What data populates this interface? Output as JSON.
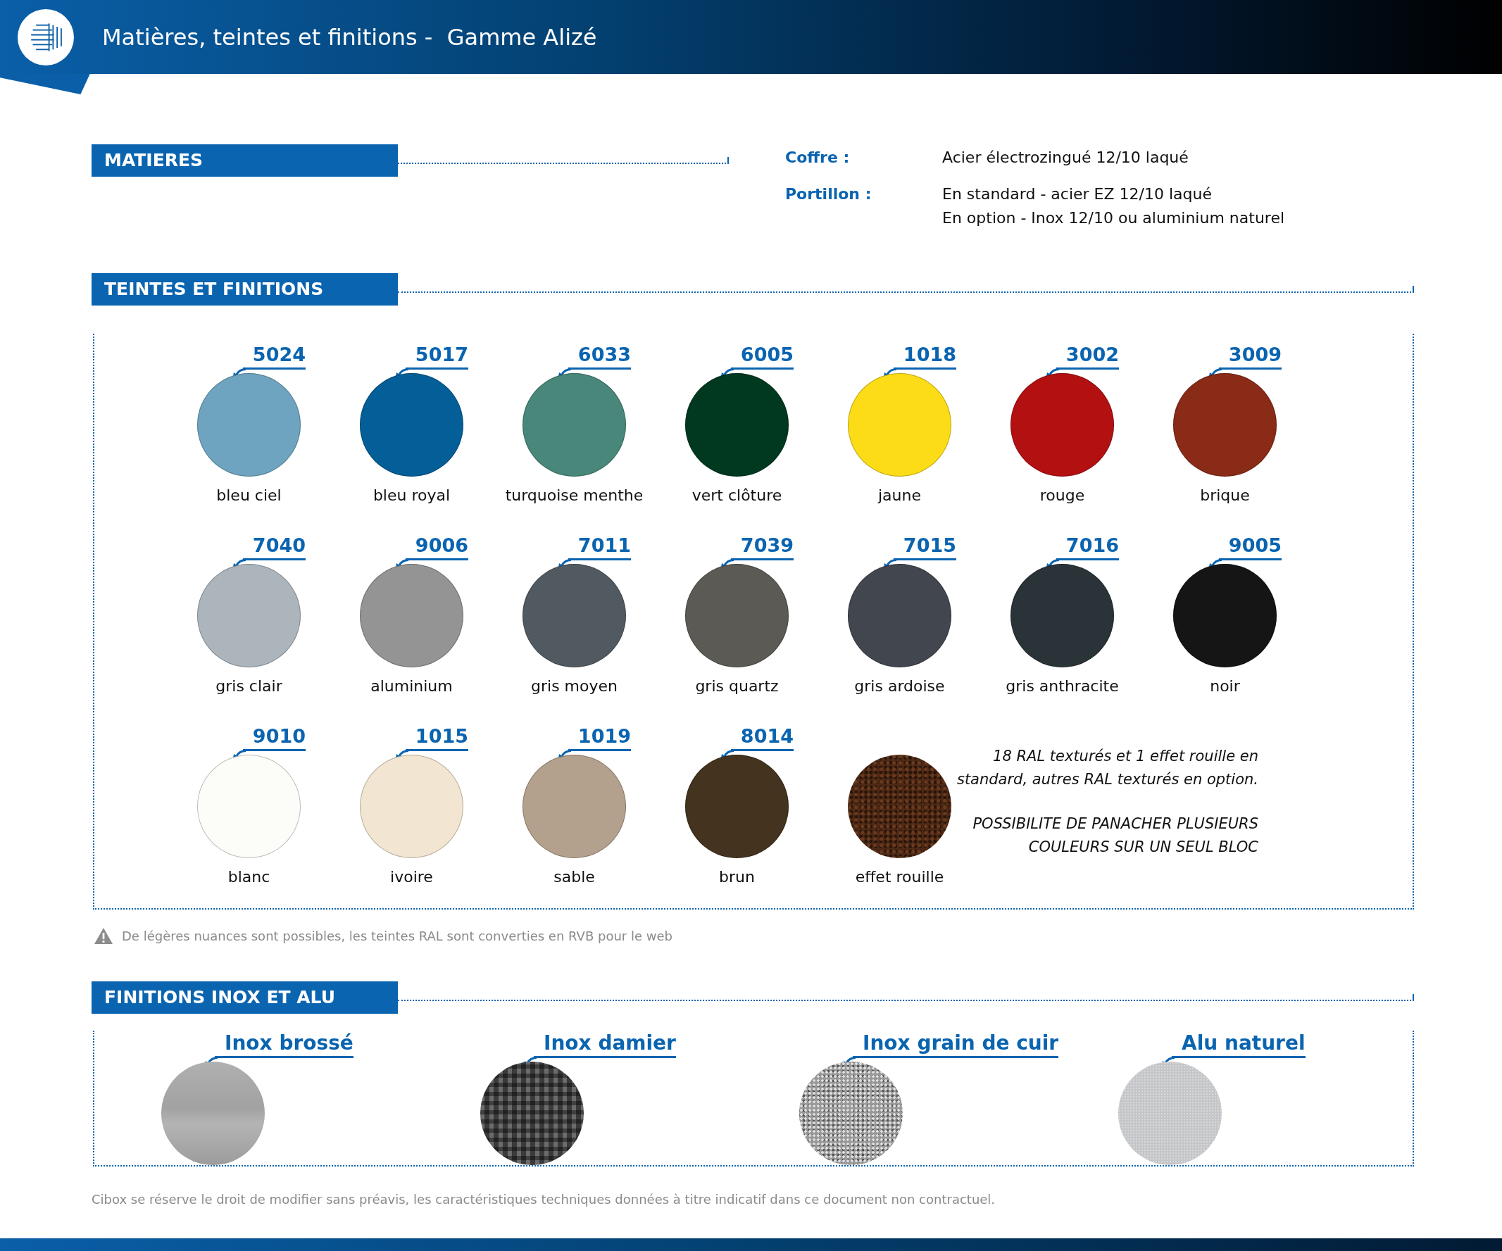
{
  "header": {
    "title": "Matières, teintes et finitions -  Gamme Alizé"
  },
  "matieres": {
    "heading": "MATIERES",
    "specs": [
      {
        "label": "Coffre :",
        "lines": [
          "Acier électrozingué 12/10 laqué"
        ]
      },
      {
        "label": "Portillon :",
        "lines": [
          "En standard  - acier EZ 12/10 laqué",
          "En option - Inox 12/10 ou aluminium naturel"
        ]
      }
    ]
  },
  "teintes": {
    "heading": "TEINTES ET FINITIONS",
    "swatches": [
      {
        "code": "5024",
        "name": "bleu ciel",
        "kind": "solid",
        "color": "#6ea4bf"
      },
      {
        "code": "5017",
        "name": "bleu royal",
        "kind": "solid",
        "color": "#045f98"
      },
      {
        "code": "6033",
        "name": "turquoise menthe",
        "kind": "solid",
        "color": "#48877a"
      },
      {
        "code": "6005",
        "name": "vert clôture",
        "kind": "solid",
        "color": "#003820"
      },
      {
        "code": "1018",
        "name": "jaune",
        "kind": "solid",
        "color": "#fcdc17"
      },
      {
        "code": "3002",
        "name": "rouge",
        "kind": "solid",
        "color": "#b31012"
      },
      {
        "code": "3009",
        "name": "brique",
        "kind": "solid",
        "color": "#8a2b17"
      },
      {
        "code": "7040",
        "name": "gris clair",
        "kind": "solid",
        "color": "#adb5bc"
      },
      {
        "code": "9006",
        "name": "aluminium",
        "kind": "solid",
        "color": "#939493"
      },
      {
        "code": "7011",
        "name": "gris moyen",
        "kind": "solid",
        "color": "#525a61"
      },
      {
        "code": "7039",
        "name": "gris quartz",
        "kind": "solid",
        "color": "#5b5a55"
      },
      {
        "code": "7015",
        "name": "gris ardoise",
        "kind": "solid",
        "color": "#41464f"
      },
      {
        "code": "7016",
        "name": "gris anthracite",
        "kind": "solid",
        "color": "#2a3338"
      },
      {
        "code": "9005",
        "name": "noir",
        "kind": "solid",
        "color": "#151515"
      },
      {
        "code": "9010",
        "name": "blanc",
        "kind": "solid",
        "color": "#fcfdf8"
      },
      {
        "code": "1015",
        "name": "ivoire",
        "kind": "solid",
        "color": "#f2e5d1"
      },
      {
        "code": "1019",
        "name": "sable",
        "kind": "solid",
        "color": "#b3a18d"
      },
      {
        "code": "8014",
        "name": "brun",
        "kind": "solid",
        "color": "#43331f"
      },
      {
        "name": "effet rouille",
        "kind": "rust"
      }
    ],
    "notes": [
      "18 RAL texturés et 1 effet rouille en standard, autres RAL texturés en option.",
      "POSSIBILITE DE PANACHER PLUSIEURS COULEURS SUR UN SEUL BLOC"
    ],
    "warning": "De légères nuances sont possibles, les teintes RAL sont converties en RVB pour le web"
  },
  "finitions": {
    "heading": "FINITIONS INOX ET ALU",
    "items": [
      {
        "name": "Inox brossé",
        "kind": "brushed"
      },
      {
        "name": "Inox damier",
        "kind": "checker"
      },
      {
        "name": "Inox grain de cuir",
        "kind": "grain"
      },
      {
        "name": "Alu naturel",
        "kind": "alu"
      }
    ]
  },
  "footer": "Cibox se réserve le droit de modifier sans préavis, les caractéristiques techniques données à titre indicatif dans ce document non contractuel."
}
